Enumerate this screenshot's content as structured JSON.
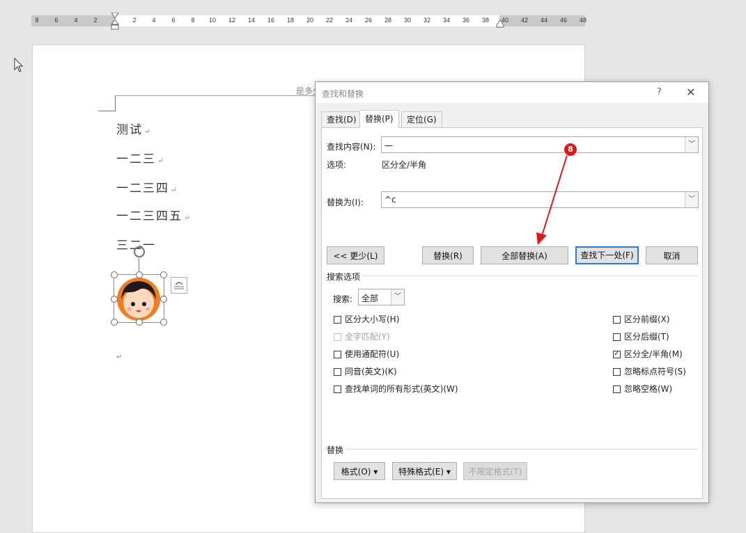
{
  "ruler": {
    "left_ticks": [
      "8",
      "6",
      "4",
      "2"
    ],
    "right_ticks": [
      "2",
      "4",
      "6",
      "8",
      "10",
      "12",
      "14",
      "16",
      "18",
      "20",
      "22",
      "24",
      "26",
      "28",
      "30",
      "32",
      "34",
      "36",
      "38",
      "40",
      "42",
      "44",
      "46",
      "48"
    ]
  },
  "document": {
    "header_text": "是多少",
    "lines": [
      "测试",
      "一二三",
      "一二三四",
      "一二三四五",
      "三二一"
    ],
    "pilcrow": "↵"
  },
  "dialog": {
    "title": "查找和替换",
    "help": "?",
    "close": "✕",
    "tabs": [
      "查找(D)",
      "替换(P)",
      "定位(G)"
    ],
    "find_label": "查找内容(N):",
    "find_value": "一",
    "options_label": "选项:",
    "options_value": "区分全/半角",
    "replace_label": "替换为(I):",
    "replace_value": "^c",
    "buttons": {
      "less": "<< 更少(L)",
      "replace": "替换(R)",
      "replace_all": "全部替换(A)",
      "find_next": "查找下一处(F)",
      "cancel": "取消"
    },
    "search_options_title": "搜索选项",
    "search_label": "搜索:",
    "search_value": "全部",
    "left_checks": [
      {
        "label": "区分大小写(H)",
        "checked": false,
        "disabled": false
      },
      {
        "label": "全字匹配(Y)",
        "checked": false,
        "disabled": true
      },
      {
        "label": "使用通配符(U)",
        "checked": false,
        "disabled": false
      },
      {
        "label": "同音(英文)(K)",
        "checked": false,
        "disabled": false
      },
      {
        "label": "查找单词的所有形式(英文)(W)",
        "checked": false,
        "disabled": false
      }
    ],
    "right_checks": [
      {
        "label": "区分前缀(X)",
        "checked": false
      },
      {
        "label": "区分后缀(T)",
        "checked": false
      },
      {
        "label": "区分全/半角(M)",
        "checked": true
      },
      {
        "label": "忽略标点符号(S)",
        "checked": false
      },
      {
        "label": "忽略空格(W)",
        "checked": false
      }
    ],
    "replace_section_title": "替换",
    "format_btn": "格式(O) ▾",
    "special_btn": "特殊格式(E) ▾",
    "no_format_btn": "不限定格式(T)"
  },
  "annotation": {
    "step": "8",
    "color": "#e01818"
  }
}
